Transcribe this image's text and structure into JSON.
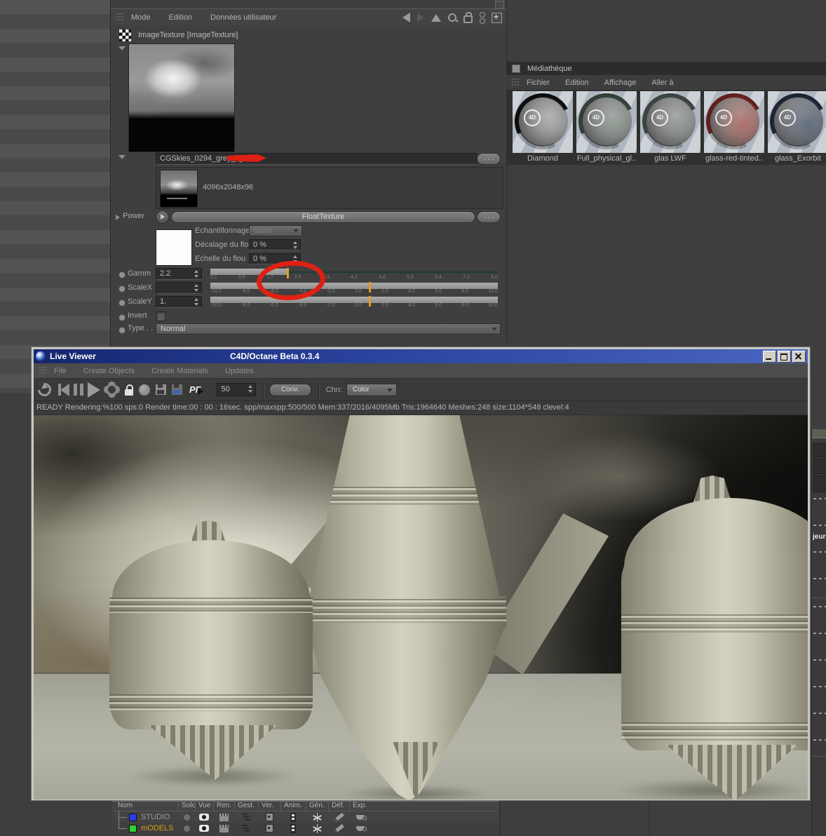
{
  "colors": {
    "accent_orange": "#e69b1e",
    "annotation_red": "#df2113",
    "titlebar_blue": "#15266f"
  },
  "attribute_panel": {
    "menu": [
      "Mode",
      "Edition",
      "Données utilisateur"
    ],
    "title": "ImageTexture [ImageTexture]",
    "filename": "CGSkies_0294_grey_light.hdr",
    "browse_label": ". . .",
    "resolution": "4096x2048x96",
    "power_label": "Power",
    "float_texture_label": "FloatTexture",
    "sampling_label": "Echantillonnage",
    "sampling_value": "Sans",
    "blur_offset_label": "Décalage du flou",
    "blur_offset_value": "0 %",
    "blur_scale_label": "Echelle du flou",
    "blur_scale_value": "0 %",
    "gamma_label": "Gamm",
    "gamma_value": "2.2",
    "gamma_ticks": [
      "0.1",
      "0.9",
      "1.7",
      "2.5",
      "3.3",
      "4.1",
      "4.8",
      "5.6",
      "6.4",
      "7.2",
      "8.0"
    ],
    "scalex_label": "ScaleX",
    "scalex_value": "",
    "scaley_label": "ScaleY",
    "scaley_value": "1.",
    "scale_ticks": [
      "-10.0",
      "-8.0",
      "-6.0",
      "-4.0",
      "-2.0",
      "0.0",
      "2.0",
      "4.0",
      "6.0",
      "8.0",
      "10.0"
    ],
    "invert_label": "Invert",
    "type_label": "Type . .",
    "type_value": "Normal"
  },
  "mediatheque": {
    "title": "Médiathèque",
    "menu": [
      "Fichier",
      "Edition",
      "Affichage",
      "Aller à"
    ],
    "logo_text": "4D",
    "materials": [
      {
        "name": "Diamond",
        "ring": "#0d0d0d",
        "tint": "rgba(245,245,245,0.18)"
      },
      {
        "name": "Full_physical_gl..",
        "ring": "#323f37",
        "tint": "rgba(130,160,140,0.30)"
      },
      {
        "name": "glas LWF",
        "ring": "#3a453f",
        "tint": "rgba(140,160,150,0.25)"
      },
      {
        "name": "glass-red-tinted..",
        "ring": "#61201d",
        "tint": "rgba(195,75,65,0.50)"
      },
      {
        "name": "glass_Exorbit",
        "ring": "#1c2533",
        "tint": "rgba(55,75,105,0.55)"
      }
    ]
  },
  "live_viewer": {
    "title": "Live Viewer",
    "version": "C4D/Octane Beta 0.3.4",
    "menu": [
      "File",
      "Create Objects",
      "Create Materials",
      "Updates"
    ],
    "toolbar": {
      "pf_label": "PF",
      "samples_value": "50",
      "convert_label": "Conv.",
      "channel_label": "Chn:",
      "channel_value": "Color"
    },
    "status": "READY Rendering:%100 sps:0 Render time:00 : 00 : 16sec. spp/maxspp:500/500 Mem:337/2016/4095Mb Tris:1964640 Meshes:248 size:1104*548 clevel:4"
  },
  "object_manager": {
    "columns": [
      "Nom",
      "Solo",
      "Vue",
      "Ren.",
      "Gest.",
      "Ver.",
      "Anim.",
      "Gén.",
      "Déf.",
      "Exp."
    ],
    "rows": [
      {
        "name": "STUDIO",
        "swatch": "#2b3cf0",
        "name_color": "#9c9c9c"
      },
      {
        "name": "mODELS",
        "swatch": "#2ed22e",
        "name_color": "#d8a018"
      }
    ]
  },
  "right_panel": {
    "clipped_label": "jeur"
  }
}
